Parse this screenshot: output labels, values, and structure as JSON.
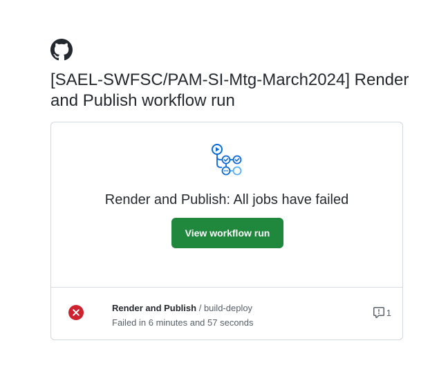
{
  "header": {
    "logo_icon": "github-mark-icon",
    "title": "[SAEL-SWFSC/PAM-SI-Mtg-March2024] Render and Publish workflow run"
  },
  "card": {
    "workflow_icon": "workflow-graph-icon",
    "heading": "Render and Publish: All jobs have failed",
    "button_label": "View workflow run",
    "button_color": "#1f883d"
  },
  "job": {
    "status_icon": "x-circle-fill-icon",
    "status_color": "#cf222e",
    "workflow_name": "Render and Publish",
    "separator": "/",
    "job_name": "build-deploy",
    "duration_text": "Failed in 6 minutes and 57 seconds",
    "annotation_icon": "comment-alert-icon",
    "annotation_count": "1"
  }
}
